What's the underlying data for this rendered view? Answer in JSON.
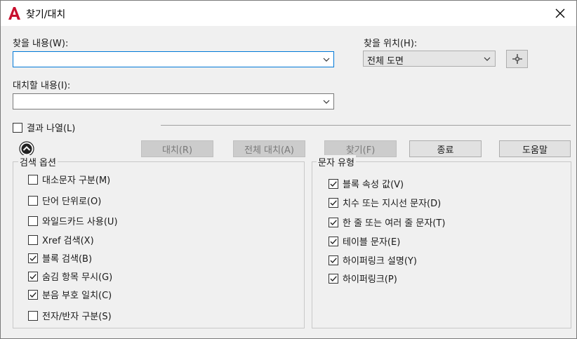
{
  "window": {
    "title": "찾기/대치",
    "logo_icon": "autocad-a-icon",
    "close_icon": "close-icon"
  },
  "find": {
    "label": "찾을 내용(W):",
    "value": ""
  },
  "location": {
    "label": "찾을 위치(H):",
    "value": "전체 도면",
    "pick_icon": "crosshair-pick-icon"
  },
  "replace": {
    "label": "대치할 내용(I):",
    "value": ""
  },
  "list_results": {
    "label": "결과 나열(L)",
    "checked": false
  },
  "buttons": {
    "replace": "대치(R)",
    "replace_all": "전체 대치(A)",
    "find": "찾기(F)",
    "done": "종료",
    "help": "도움말"
  },
  "search_options": {
    "title": "검색 옵션",
    "items": [
      {
        "label": "대소문자 구분(M)",
        "checked": false
      },
      {
        "label": "단어 단위로(O)",
        "checked": false
      },
      {
        "label": "와일드카드 사용(U)",
        "checked": false
      },
      {
        "label": "Xref 검색(X)",
        "checked": false
      },
      {
        "label": "블록 검색(B)",
        "checked": true
      },
      {
        "label": "숨김 항목 무시(G)",
        "checked": true
      },
      {
        "label": "분음 부호 일치(C)",
        "checked": true
      },
      {
        "label": "전자/반자 구분(S)",
        "checked": false
      }
    ]
  },
  "text_types": {
    "title": "문자 유형",
    "items": [
      {
        "label": "블록 속성 값(V)",
        "checked": true
      },
      {
        "label": "치수 또는 지시선 문자(D)",
        "checked": true
      },
      {
        "label": "한 줄 또는 여러 줄 문자(T)",
        "checked": true
      },
      {
        "label": "테이블 문자(E)",
        "checked": true
      },
      {
        "label": "하이퍼링크 설명(Y)",
        "checked": true
      },
      {
        "label": "하이퍼링크(P)",
        "checked": true
      }
    ]
  },
  "colors": {
    "accent": "#0078d7",
    "logo": "#c8102e"
  }
}
